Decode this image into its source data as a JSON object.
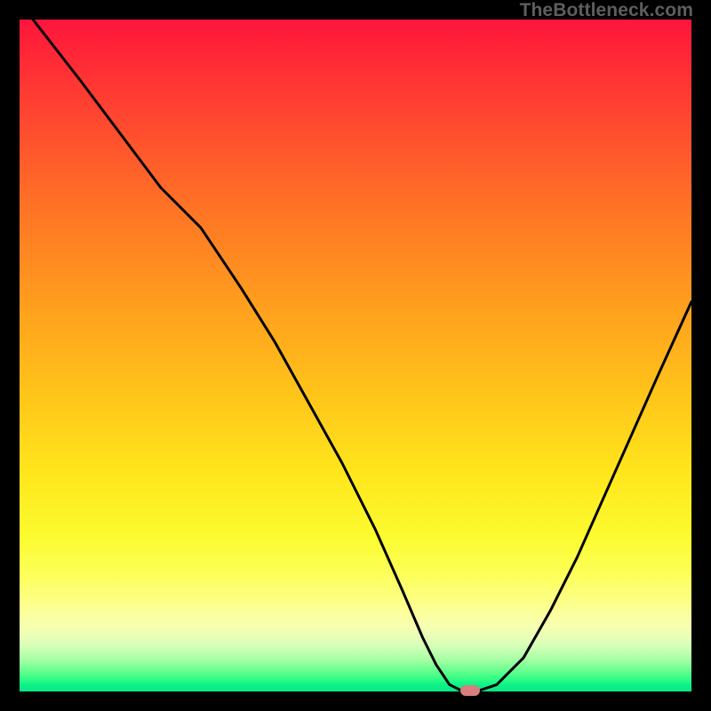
{
  "watermark": "TheBottleneck.com",
  "marker_color": "#d97d7d",
  "chart_data": {
    "type": "line",
    "title": "",
    "xlabel": "",
    "ylabel": "",
    "xlim": [
      0,
      100
    ],
    "ylim": [
      0,
      100
    ],
    "series": [
      {
        "name": "bottleneck-curve",
        "x": [
          2,
          9,
          15,
          21,
          27,
          33,
          38,
          43,
          48,
          53,
          57,
          60,
          62,
          64,
          66,
          68,
          71,
          75,
          79,
          83,
          87,
          91,
          95,
          100
        ],
        "values": [
          100,
          91,
          83,
          75,
          69,
          60,
          52,
          43,
          34,
          24,
          15,
          8,
          4,
          1,
          0,
          0,
          1,
          5,
          12,
          20,
          29,
          38,
          47,
          58
        ]
      }
    ],
    "annotations": [
      {
        "name": "optimal-marker",
        "x": 67,
        "y": 0
      }
    ]
  }
}
